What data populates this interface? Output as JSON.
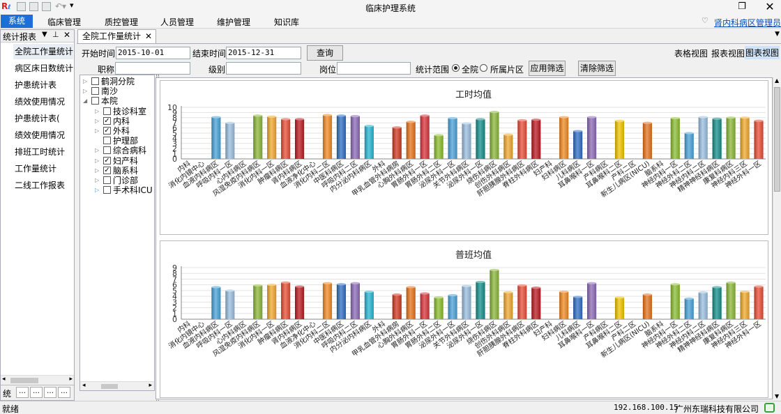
{
  "app": {
    "title": "临床护理系统"
  },
  "menu": {
    "items": [
      "系统",
      "临床管理",
      "质控管理",
      "人员管理",
      "维护管理",
      "知识库"
    ],
    "ward_link": "肾内科病区",
    "user_link": "管理员"
  },
  "left_panel": {
    "title": "统计报表",
    "tab_label": "统",
    "items": [
      "全院工作量统计",
      "病区床日数统计",
      "护患统计表",
      "绩效使用情况",
      "护患统计表(",
      "绩效使用情况",
      "排班工时统计",
      "工作量统计",
      "二线工作报表"
    ]
  },
  "main": {
    "doc_tab": "全院工作量统计",
    "filters": {
      "start_label": "开始时间",
      "start_value": "2015-10-01",
      "end_label": "结束时间",
      "end_value": "2015-12-31",
      "query_button": "查询",
      "title_label": "职称",
      "level_label": "级别",
      "post_label": "岗位",
      "scope_label": "统计范围",
      "scope_all": "全院",
      "scope_ward": "所属片区",
      "apply_button": "应用筛选",
      "clear_button": "清除筛选"
    },
    "views": {
      "table": "表格视图",
      "report": "报表视图",
      "chart": "图表视图"
    }
  },
  "tree": [
    {
      "label": "鹤洞分院",
      "level": 0,
      "expander": "collapsed",
      "checked": false
    },
    {
      "label": "南沙",
      "level": 0,
      "expander": "collapsed",
      "checked": false
    },
    {
      "label": "本院",
      "level": 0,
      "expander": "expanded",
      "checked": false
    },
    {
      "label": "技诊科室",
      "level": 1,
      "expander": "collapsed",
      "checked": false
    },
    {
      "label": "内科",
      "level": 1,
      "expander": "collapsed",
      "checked": true
    },
    {
      "label": "外科",
      "level": 1,
      "expander": "collapsed",
      "checked": true
    },
    {
      "label": "护理部",
      "level": 1,
      "expander": "none",
      "checked": false
    },
    {
      "label": "综合病科",
      "level": 1,
      "expander": "collapsed",
      "checked": false
    },
    {
      "label": "妇产科",
      "level": 1,
      "expander": "collapsed",
      "checked": true
    },
    {
      "label": "脑系科",
      "level": 1,
      "expander": "collapsed",
      "checked": true
    },
    {
      "label": "门诊部",
      "level": 1,
      "expander": "collapsed",
      "checked": false
    },
    {
      "label": "手术科ICU",
      "level": 1,
      "expander": "collapsed-blue",
      "checked": false
    }
  ],
  "status": {
    "left": "就绪",
    "ip": "192.168.100.15",
    "company": "广州东瑞科技有限公司"
  },
  "colors": {
    "accent": "#1c6fd6",
    "bar_palette": [
      "#d8363c",
      "#8cbf2e",
      "#4aa3d9",
      "#9bbfe0",
      "#16908b",
      "#8cb83a",
      "#f1a92e",
      "#e84f35",
      "#bd1b22",
      "#a07fc0",
      "#f28b22",
      "#2f6fc4",
      "#8d6bb8",
      "#25b7d3",
      "#f4c400",
      "#cf3a22",
      "#e8731b"
    ]
  },
  "chart_data": [
    {
      "type": "bar",
      "title": "工时均值",
      "ylim": [
        0,
        10
      ],
      "yticks": [
        0,
        1,
        2,
        3,
        4,
        5,
        6,
        7,
        8,
        9,
        10
      ],
      "categories": [
        "内科",
        "消化内镜中心",
        "血液内科病区",
        "呼吸内科一区",
        "心内科病区",
        "风湿免疫内科病区",
        "消化内科一区",
        "肿瘤科病区",
        "肾内科病区",
        "血液净化中心",
        "消化内科二区",
        "中医科病区",
        "呼吸内科二区",
        "内分泌内科病区",
        "外科",
        "甲乳血管外科病房",
        "心胸外科病区",
        "胃肠外科一区",
        "胃肠外科二区",
        "泌尿外科一区",
        "关节外科病区",
        "泌尿外科一区",
        "烧伤科病区",
        "创伤外科病区",
        "肝胆胰腺外科病区",
        "脊柱外科病区",
        "妇产科",
        "妇科病区",
        "儿科病区",
        "耳鼻喉科一区",
        "产科病区",
        "耳鼻喉科二区",
        "产科二区",
        "新生儿病区(NICU)",
        "脑系科",
        "神经内科一区",
        "神经外科二区",
        "神经内科二区",
        "精神神经科病区",
        "康复科病区",
        "神经内科三区",
        "神经外科一区"
      ],
      "values": [
        0,
        0,
        8.1,
        7,
        0,
        8.4,
        8.2,
        7.7,
        7.7,
        0,
        8.5,
        8.4,
        8.3,
        6.4,
        0,
        6.1,
        7.2,
        8.4,
        4.6,
        7.9,
        6.9,
        7.7,
        9.1,
        4.7,
        7.5,
        7.6,
        0,
        8.1,
        5.4,
        8.1,
        0,
        7.4,
        0,
        7.0,
        0,
        7.9,
        5.0,
        8.1,
        7.8,
        8.0,
        8.0,
        7.4
      ]
    },
    {
      "type": "bar",
      "title": "普班均值",
      "ylim": [
        0,
        9
      ],
      "yticks": [
        0,
        1,
        2,
        3,
        4,
        5,
        6,
        7,
        8,
        9
      ],
      "categories": [
        "内科",
        "消化内镜中心",
        "血液内科病区",
        "呼吸内科一区",
        "心内科病区",
        "风湿免疫内科病区",
        "消化内科一区",
        "肿瘤科病区",
        "肾内科病区",
        "血液净化中心",
        "消化内科二区",
        "中医科病区",
        "呼吸内科二区",
        "内分泌内科病区",
        "外科",
        "甲乳血管外科病房",
        "心胸外科病区",
        "胃肠外科一区",
        "胃肠外科二区",
        "泌尿外科一区",
        "关节外科病区",
        "泌尿外科一区",
        "烧伤科病区",
        "创伤外科病区",
        "肝胆胰腺外科病区",
        "脊柱外科病区",
        "妇产科",
        "妇科病区",
        "儿科病区",
        "耳鼻喉科一区",
        "产科病区",
        "耳鼻喉科二区",
        "产科二区",
        "新生儿病区(NICU)",
        "脑系科",
        "神经内科一区",
        "神经外科二区",
        "神经内科二区",
        "精神神经科病区",
        "康复科病区",
        "神经内科三区",
        "神经外科一区"
      ],
      "values": [
        0,
        0,
        5.6,
        5.0,
        0,
        5.9,
        6.0,
        6.4,
        5.7,
        0,
        6.3,
        6.1,
        6.3,
        4.8,
        0,
        4.3,
        5.6,
        4.5,
        3.8,
        4.2,
        5.8,
        6.5,
        8.6,
        4.7,
        5.9,
        5.5,
        0,
        4.8,
        3.9,
        6.3,
        0,
        3.8,
        0,
        4.3,
        0,
        6.1,
        3.6,
        4.7,
        5.6,
        6.4,
        4.8,
        5.7
      ]
    }
  ]
}
